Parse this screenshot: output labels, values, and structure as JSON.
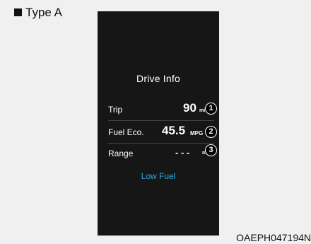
{
  "header": {
    "type_label": "Type A"
  },
  "screen": {
    "title": "Drive Info",
    "rows": [
      {
        "label": "Trip",
        "value": "90",
        "unit": "mi",
        "marker": "1"
      },
      {
        "label": "Fuel Eco.",
        "value": "45.5",
        "unit": "MPG",
        "marker": "2"
      },
      {
        "label": "Range",
        "value": "- - -",
        "unit": "mi",
        "marker": "3"
      }
    ],
    "warning": "Low Fuel"
  },
  "figure_code": "OAEPH047194N",
  "colors": {
    "screen_bg": "#161616",
    "warning_text": "#29a8e0"
  }
}
